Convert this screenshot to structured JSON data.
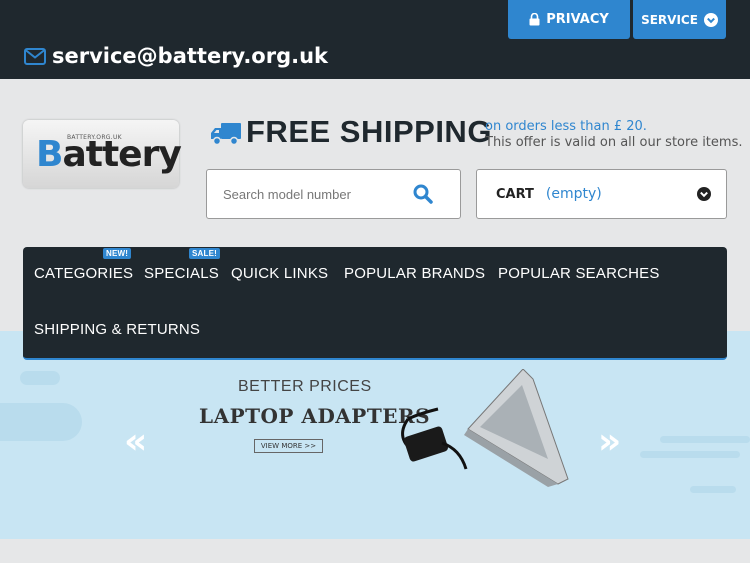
{
  "header": {
    "privacy_label": "PRIVACY",
    "service_label": "SERVICE",
    "email": "service@battery.org.uk"
  },
  "logo": {
    "small_text": "BATTERY.ORG.UK",
    "text_first": "B",
    "text_rest": "attery"
  },
  "shipping": {
    "title": "FREE SHIPPING",
    "line1": "on orders less than £ 20.",
    "line2": "This offer is valid on all our store items."
  },
  "search": {
    "placeholder": "Search model number"
  },
  "cart": {
    "label": "CART",
    "status": "(empty)"
  },
  "nav": {
    "items": [
      {
        "label": "CATEGORIES",
        "badge": "NEW!"
      },
      {
        "label": "SPECIALS",
        "badge": "SALE!"
      },
      {
        "label": "QUICK LINKS"
      },
      {
        "label": "POPULAR BRANDS"
      },
      {
        "label": "POPULAR SEARCHES"
      },
      {
        "label": "SHIPPING & RETURNS"
      }
    ]
  },
  "banner": {
    "line1": "BETTER PRICES",
    "line2": "LAPTOP ADAPTERS",
    "button": "VIEW MORE >>",
    "prev": "«",
    "next": "»"
  },
  "colors": {
    "accent": "#2f86cf",
    "dark": "#1f282e",
    "banner_bg": "#c8e5f3"
  },
  "icons": [
    "lock-icon",
    "chevron-circle-down-icon",
    "envelope-icon",
    "truck-icon",
    "search-icon"
  ]
}
